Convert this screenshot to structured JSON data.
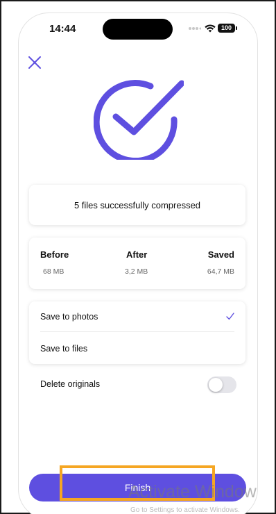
{
  "status_bar": {
    "time": "14:44",
    "battery": "100"
  },
  "message": "5 files successfully compressed",
  "stats": {
    "before_label": "Before",
    "before_value": "68 MB",
    "after_label": "After",
    "after_value": "3,2 MB",
    "saved_label": "Saved",
    "saved_value": "64,7 MB"
  },
  "save_options": [
    {
      "label": "Save to photos",
      "selected": true
    },
    {
      "label": "Save to files",
      "selected": false
    }
  ],
  "delete_originals": {
    "label": "Delete originals",
    "enabled": false
  },
  "finish_label": "Finish",
  "watermark": {
    "title": "Activate Window",
    "subtitle": "Go to Settings to activate Windows."
  },
  "colors": {
    "accent": "#5e4fe0",
    "highlight": "#f5a623"
  },
  "icons": [
    "close-icon",
    "checkmark-circle-icon",
    "checkmark-icon",
    "wifi-icon",
    "signal-dots-icon"
  ]
}
